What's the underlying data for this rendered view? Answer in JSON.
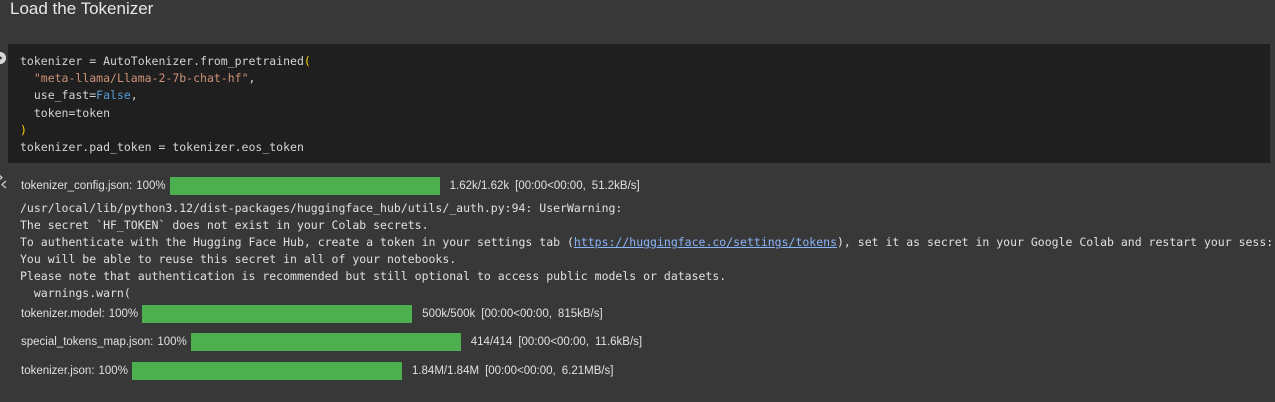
{
  "section": {
    "title": "Load the Tokenizer"
  },
  "code_cell": {
    "lines": {
      "l1_a": "tokenizer = AutoTokenizer.from_pretrained",
      "l1_paren": "(",
      "l2_indent": "  ",
      "l2_str": "\"meta-llama/Llama-2-7b-chat-hf\"",
      "l2_comma": ",",
      "l3_a": "  use_fast=",
      "l3_kw": "False",
      "l3_comma": ",",
      "l4": "  token=token",
      "l5_paren": ")",
      "l6": "tokenizer.pad_token = tokenizer.eos_token"
    }
  },
  "output": {
    "progress": [
      {
        "filename": "tokenizer_config.json:",
        "percent": "100%",
        "fraction": 1.0,
        "size": "1.62k/1.62k",
        "time": "[00:00<00:00,",
        "speed": "51.2kB/s]"
      },
      {
        "filename": "tokenizer.model:",
        "percent": "100%",
        "fraction": 1.0,
        "size": "500k/500k",
        "time": "[00:00<00:00,",
        "speed": "815kB/s]"
      },
      {
        "filename": "special_tokens_map.json:",
        "percent": "100%",
        "fraction": 1.0,
        "size": "414/414",
        "time": "[00:00<00:00,",
        "speed": "11.6kB/s]"
      },
      {
        "filename": "tokenizer.json:",
        "percent": "100%",
        "fraction": 1.0,
        "size": "1.84M/1.84M",
        "time": "[00:00<00:00,",
        "speed": "6.21MB/s]"
      }
    ],
    "warning": {
      "line1": "/usr/local/lib/python3.12/dist-packages/huggingface_hub/utils/_auth.py:94: UserWarning:",
      "line2": "The secret `HF_TOKEN` does not exist in your Colab secrets.",
      "line3_a": "To authenticate with the Hugging Face Hub, create a token in your settings tab (",
      "line3_link": "https://huggingface.co/settings/tokens",
      "line3_b": "), set it as secret in your Google Colab and restart your sess:",
      "line4": "You will be able to reuse this secret in all of your notebooks.",
      "line5": "Please note that authentication is recommended but still optional to access public models or datasets.",
      "line6": "  warnings.warn("
    }
  },
  "colors": {
    "background": "#383838",
    "code_background": "#1f1f1f",
    "progress_fill": "#4caf50",
    "string": "#ce9178",
    "keyword": "#569cd6",
    "link": "#8ab4f8"
  },
  "icons": {
    "run": "run-cell-icon",
    "output": "output-toggle-icon"
  }
}
